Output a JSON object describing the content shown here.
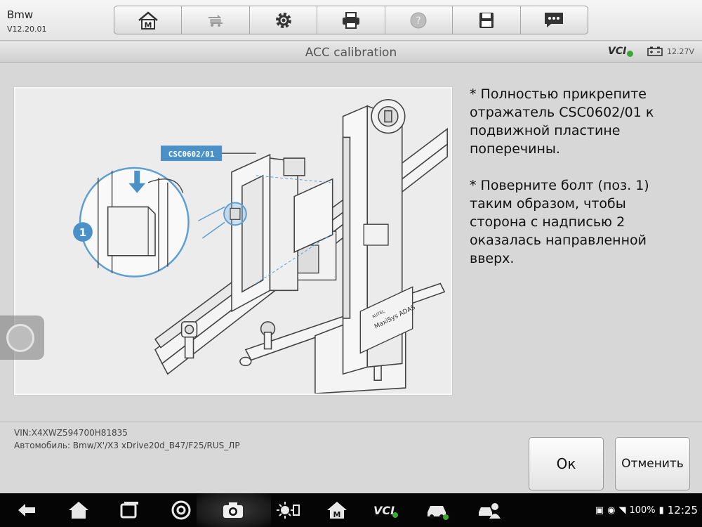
{
  "app": {
    "title": "Bmw",
    "version": "V12.20.01"
  },
  "toolbar": {
    "items": [
      {
        "name": "home",
        "letter": "M"
      },
      {
        "name": "vehicle-swap"
      },
      {
        "name": "settings"
      },
      {
        "name": "print"
      },
      {
        "name": "help"
      },
      {
        "name": "save"
      },
      {
        "name": "message"
      }
    ]
  },
  "titlebar": {
    "title": "ACC calibration",
    "vci": "VCI",
    "voltage": "12.27V"
  },
  "figure": {
    "callout_label": "CSC0602/01",
    "position_marker": "1",
    "device_brand": "MaxiSys ADAS",
    "device_maker": "AUTEL"
  },
  "instructions": {
    "step1": "* Полностью прикрепите\nотражатель CSC0602/01 к\nподвижной пластине\nпоперечины.",
    "step2": "* Поверните болт (поз. 1)\nтаким образом, чтобы\nсторона с надписью 2\nоказалась направленной\nвверх."
  },
  "vehicle": {
    "vin": "VIN:X4XWZ594700H81835",
    "car": "Автомобиль: Bmw/X'/X3 xDrive20d_B47/F25/RUS_ЛР"
  },
  "buttons": {
    "ok": "Ок",
    "cancel": "Отменить"
  },
  "status": {
    "battery": "100%",
    "time": "12:25",
    "vci_nav": "VCI"
  },
  "colors": {
    "accent": "#4a90c9",
    "vci_ok": "#3aaa35"
  }
}
